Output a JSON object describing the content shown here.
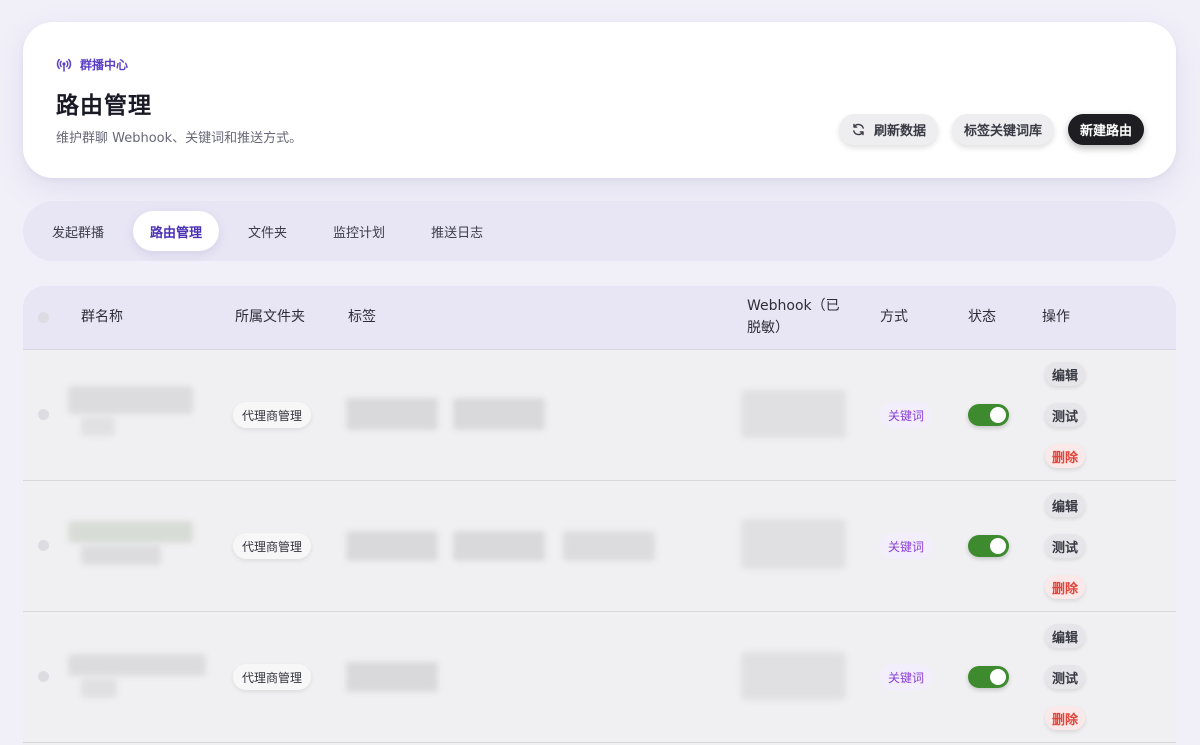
{
  "header": {
    "eyebrow": "群播中心",
    "title": "路由管理",
    "subtitle": "维护群聊 Webhook、关键词和推送方式。",
    "actions": {
      "refresh": "刷新数据",
      "keyword_library": "标签关键词库",
      "new_route": "新建路由"
    }
  },
  "tabs": [
    {
      "label": "发起群播",
      "active": false
    },
    {
      "label": "路由管理",
      "active": true
    },
    {
      "label": "文件夹",
      "active": false
    },
    {
      "label": "监控计划",
      "active": false
    },
    {
      "label": "推送日志",
      "active": false
    }
  ],
  "table": {
    "columns": {
      "name": "群名称",
      "folder": "所属文件夹",
      "tags": "标签",
      "webhook_line1": "Webhook（已",
      "webhook_line2": "脱敏）",
      "mode": "方式",
      "status": "状态",
      "actions": "操作"
    },
    "rows": [
      {
        "folder": "代理商管理",
        "mode": "关键词",
        "enabled": true,
        "edit": "编辑",
        "test": "测试",
        "delete": "删除"
      },
      {
        "folder": "代理商管理",
        "mode": "关键词",
        "enabled": true,
        "edit": "编辑",
        "test": "测试",
        "delete": "删除"
      },
      {
        "folder": "代理商管理",
        "mode": "关键词",
        "enabled": true,
        "edit": "编辑",
        "test": "测试",
        "delete": "删除"
      }
    ]
  },
  "colors": {
    "accent": "#5b3fc6",
    "toggle_on": "#3e8b2f",
    "danger": "#e2453b",
    "mode_text": "#8a40d6"
  }
}
